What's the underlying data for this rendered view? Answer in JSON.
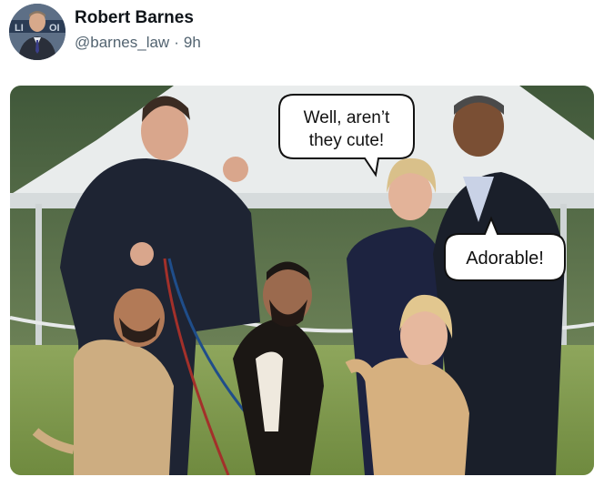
{
  "author": {
    "display_name": "Robert Barnes",
    "handle": "@barnes_law",
    "separator": "·",
    "time_ago": "9h",
    "avatar_icon": "user-avatar-icon"
  },
  "image": {
    "speech_bubble_1": {
      "line1": "Well, aren’t",
      "line2": "they cute!"
    },
    "speech_bubble_2": {
      "text": "Adorable!"
    }
  },
  "colors": {
    "name": "#0f1419",
    "secondary_text": "#536471",
    "background": "#ffffff"
  }
}
